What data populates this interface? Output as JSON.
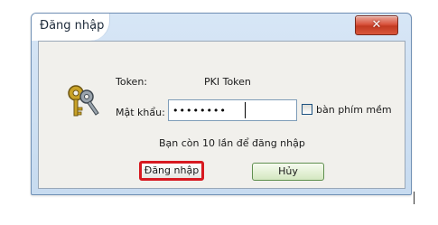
{
  "dialog": {
    "title": "Đăng nhập",
    "close_glyph": "✕"
  },
  "form": {
    "token_label": "Token:",
    "token_value": "PKI Token",
    "password_label": "Mật khẩu:",
    "password_value": "••••••••",
    "onscreen_keyboard_label": "bàn phím mềm",
    "onscreen_keyboard_checked": false,
    "attempts_message": "Bạn còn 10 lần để đăng nhập"
  },
  "buttons": {
    "login_label": "Đăng nhập",
    "cancel_label": "Hủy"
  },
  "colors": {
    "highlight_border": "#d71920",
    "close_button": "#d9533d",
    "cancel_button": "#d3e7c0"
  },
  "icons": {
    "dialog_icon": "keys-icon"
  }
}
